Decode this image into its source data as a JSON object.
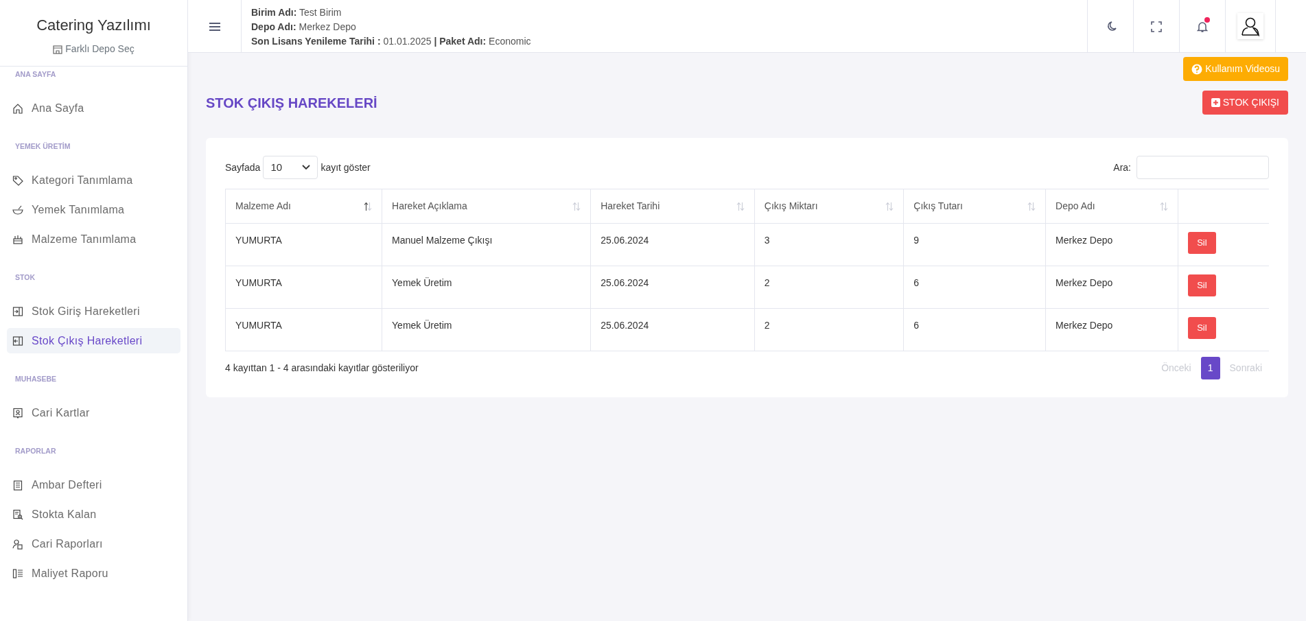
{
  "sidebar": {
    "brand": "Catering Yazılımı",
    "depot_link": "Farklı Depo Seç",
    "sections": [
      {
        "title": "ANA SAYFA",
        "items": [
          {
            "label": "Ana Sayfa",
            "selected": false
          }
        ]
      },
      {
        "title": "YEMEK ÜRETİM",
        "items": [
          {
            "label": "Kategori Tanımlama",
            "selected": false
          },
          {
            "label": "Yemek Tanımlama",
            "selected": false
          },
          {
            "label": "Malzeme Tanımlama",
            "selected": false
          }
        ]
      },
      {
        "title": "STOK",
        "items": [
          {
            "label": "Stok Giriş Hareketleri",
            "selected": false
          },
          {
            "label": "Stok Çıkış Hareketleri",
            "selected": true
          }
        ]
      },
      {
        "title": "MUHASEBE",
        "items": [
          {
            "label": "Cari Kartlar",
            "selected": false
          }
        ]
      },
      {
        "title": "RAPORLAR",
        "items": [
          {
            "label": "Ambar Defteri",
            "selected": false
          },
          {
            "label": "Stokta Kalan",
            "selected": false
          },
          {
            "label": "Cari Raporları",
            "selected": false
          },
          {
            "label": "Maliyet Raporu",
            "selected": false
          }
        ]
      }
    ]
  },
  "header": {
    "info_lines": [
      "**Birim Adı:** Test Birim",
      "**Depo Adı:** Merkez Depo",
      "**Son Lisans Yenileme Tarihi :** 01.01.2025 **| Paket Adı:** Economic"
    ],
    "notifications_unread": true
  },
  "help_button": "Kullanım Videosu",
  "page_title": "STOK ÇIKIŞ HAREKELERİ",
  "add_button": "STOK ÇIKIŞI",
  "table_controls": {
    "length_before": "Sayfada",
    "length_value": "10",
    "length_after": "kayıt göster",
    "search_label": "Ara:"
  },
  "table": {
    "columns": [
      {
        "label": "Malzeme Adı",
        "sorted_ascending": true
      },
      {
        "label": "Hareket Açıklama",
        "sorted_ascending": false
      },
      {
        "label": "Hareket Tarihi",
        "sorted_ascending": false
      },
      {
        "label": "Çıkış Miktarı",
        "sorted_ascending": false
      },
      {
        "label": "Çıkış Tutarı",
        "sorted_ascending": false
      },
      {
        "label": "Depo Adı",
        "sorted_ascending": false
      }
    ],
    "rows": [
      {
        "cells": [
          "YUMURTA",
          "Manuel Malzeme Çıkışı",
          "25.06.2024",
          "3",
          "9",
          "Merkez Depo"
        ],
        "action": "Sil"
      },
      {
        "cells": [
          "YUMURTA",
          "Yemek Üretim",
          "25.06.2024",
          "2",
          "6",
          "Merkez Depo"
        ],
        "action": "Sil"
      },
      {
        "cells": [
          "YUMURTA",
          "Yemek Üretim",
          "25.06.2024",
          "2",
          "6",
          "Merkez Depo"
        ],
        "action": "Sil"
      }
    ]
  },
  "table_info": "4 kayıttan 1 - 4 arasındaki kayıtlar gösteriliyor",
  "pagination": {
    "previous": {
      "label": "Önceki",
      "disabled": true
    },
    "pages": [
      {
        "label": "1",
        "selected": true
      }
    ],
    "next": {
      "label": "Sonraki",
      "disabled": true
    }
  }
}
